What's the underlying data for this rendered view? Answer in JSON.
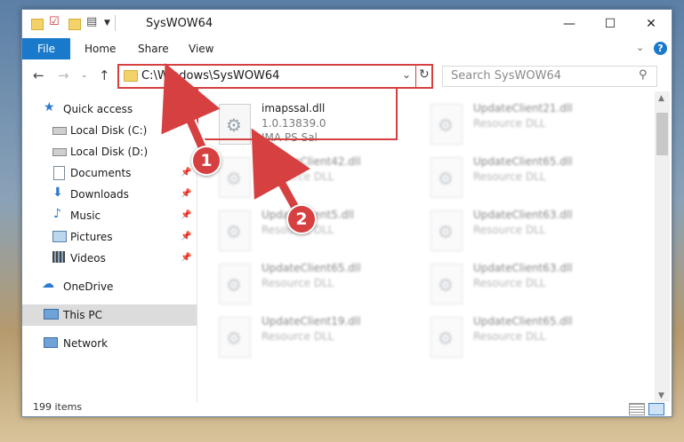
{
  "window": {
    "title": "SysWOW64"
  },
  "window_controls": {
    "minimize": "—",
    "maximize": "☐",
    "close": "✕"
  },
  "ribbon": {
    "file_tab": "File",
    "tabs": [
      "Home",
      "Share",
      "View"
    ]
  },
  "address_bar": {
    "path": "C:\\Windows\\SysWOW64"
  },
  "search": {
    "placeholder": "Search SysWOW64"
  },
  "sidebar": {
    "quick_access": "Quick access",
    "items": [
      {
        "label": "Local Disk (C:)"
      },
      {
        "label": "Local Disk (D:)"
      },
      {
        "label": "Documents"
      },
      {
        "label": "Downloads"
      },
      {
        "label": "Music"
      },
      {
        "label": "Pictures"
      },
      {
        "label": "Videos"
      }
    ],
    "onedrive": "OneDrive",
    "this_pc": "This PC",
    "network": "Network"
  },
  "files": {
    "highlighted": {
      "name": "imapssal.dll",
      "version": "1.0.13839.0",
      "description": "IMA PS Sal"
    },
    "right_column": [
      {
        "name": "UpdateClient21.dll",
        "type": "Resource DLL"
      },
      {
        "name": "UpdateClient65.dll",
        "type": "Resource DLL"
      },
      {
        "name": "UpdateClient63.dll",
        "type": "Resource DLL"
      },
      {
        "name": "UpdateClient63.dll",
        "type": "Resource DLL"
      },
      {
        "name": "UpdateClient65.dll",
        "type": "Resource DLL"
      }
    ],
    "left_column": [
      {
        "name": "UpdateClient42.dll",
        "type": "Resource DLL"
      },
      {
        "name": "UpdateClient5.dll",
        "type": "Resource DLL"
      },
      {
        "name": "UpdateClient65.dll",
        "type": "Resource DLL"
      },
      {
        "name": "UpdateClient19.dll",
        "type": "Resource DLL"
      }
    ]
  },
  "status": {
    "item_count": "199 items"
  },
  "annotations": {
    "step1": "1",
    "step2": "2",
    "color": "#d64040"
  }
}
